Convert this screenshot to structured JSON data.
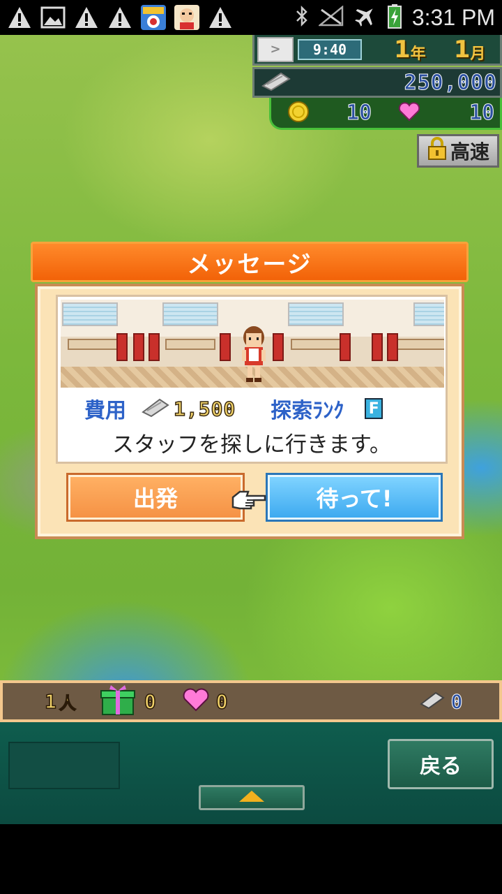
{
  "status_bar": {
    "time": "3:31 PM",
    "left_icons": [
      "warning-icon",
      "image-icon",
      "warning-icon",
      "warning-icon",
      "bingo-app-icon",
      "shinchan-app-icon",
      "warning-icon"
    ],
    "right_icons": [
      "bluetooth-icon",
      "no-signal-icon",
      "airplane-icon",
      "battery-charging-icon"
    ]
  },
  "hud": {
    "game_time": "9:40",
    "year_number": "1",
    "year_unit": "年",
    "month_number": "1",
    "month_unit": "月",
    "money": "250,000",
    "coins": "10",
    "hearts": "10",
    "speed_label": "高速"
  },
  "dialog": {
    "title": "メッセージ",
    "cost_label": "費用",
    "cost_value": "1,500",
    "rank_label": "探索ﾗﾝｸ",
    "rank_value": "F",
    "message": "スタッフを探しに行きます。",
    "depart_button": "出発",
    "wait_button": "待って!"
  },
  "inventory": {
    "staff_count": "1",
    "staff_unit": "人",
    "gift_count": "0",
    "heart_count": "0",
    "ticket_count": "0"
  },
  "bottom_panel": {
    "back_button": "戻る"
  },
  "colors": {
    "dialog_title_orange": "#f26208",
    "depart_orange": "#f59245",
    "wait_blue": "#3eaaf0",
    "panel_teal": "#0f5d4e",
    "label_blue": "#2d62c8"
  }
}
